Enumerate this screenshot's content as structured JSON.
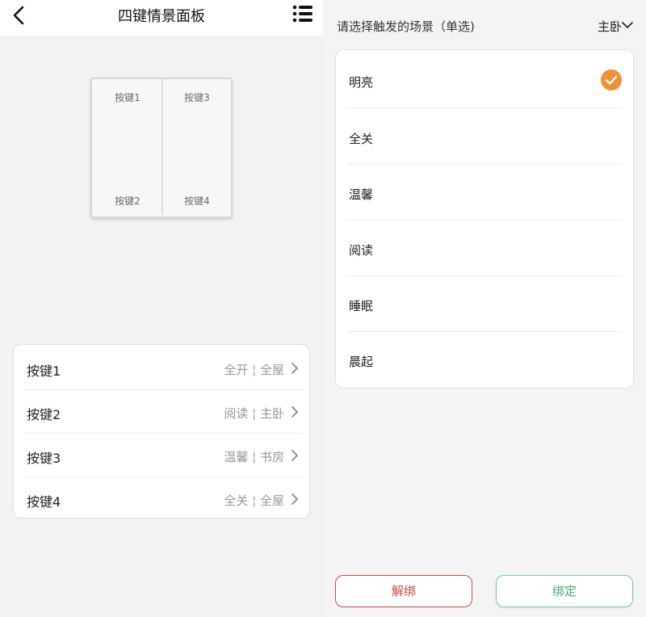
{
  "left": {
    "header": {
      "title": "四键情景面板"
    },
    "panel": {
      "keys": [
        "按键1",
        "按键2",
        "按键3",
        "按键4"
      ]
    },
    "bindings": [
      {
        "key": "按键1",
        "value": "全开 ¦ 全屋"
      },
      {
        "key": "按键2",
        "value": "阅读 ¦ 主卧"
      },
      {
        "key": "按键3",
        "value": "温馨 ¦ 书房"
      },
      {
        "key": "按键4",
        "value": "全关 ¦ 全屋"
      }
    ]
  },
  "right": {
    "prompt": "请选择触发的场景（单选)",
    "room": "主卧",
    "scenes": [
      {
        "label": "明亮",
        "selected": true
      },
      {
        "label": "全关",
        "selected": false
      },
      {
        "label": "温馨",
        "selected": false
      },
      {
        "label": "阅读",
        "selected": false
      },
      {
        "label": "睡眠",
        "selected": false
      },
      {
        "label": "晨起",
        "selected": false
      }
    ],
    "buttons": {
      "unbind": "解绑",
      "bind": "绑定"
    }
  },
  "colors": {
    "accent": "#f0913a",
    "danger": "#c94a44",
    "success": "#3cae6b"
  },
  "icons": {
    "back": "back-arrow-icon",
    "menu": "list-menu-icon",
    "chevron": "chevron-right-icon",
    "check": "check-circle-icon",
    "dropdown": "chevron-down-icon"
  }
}
